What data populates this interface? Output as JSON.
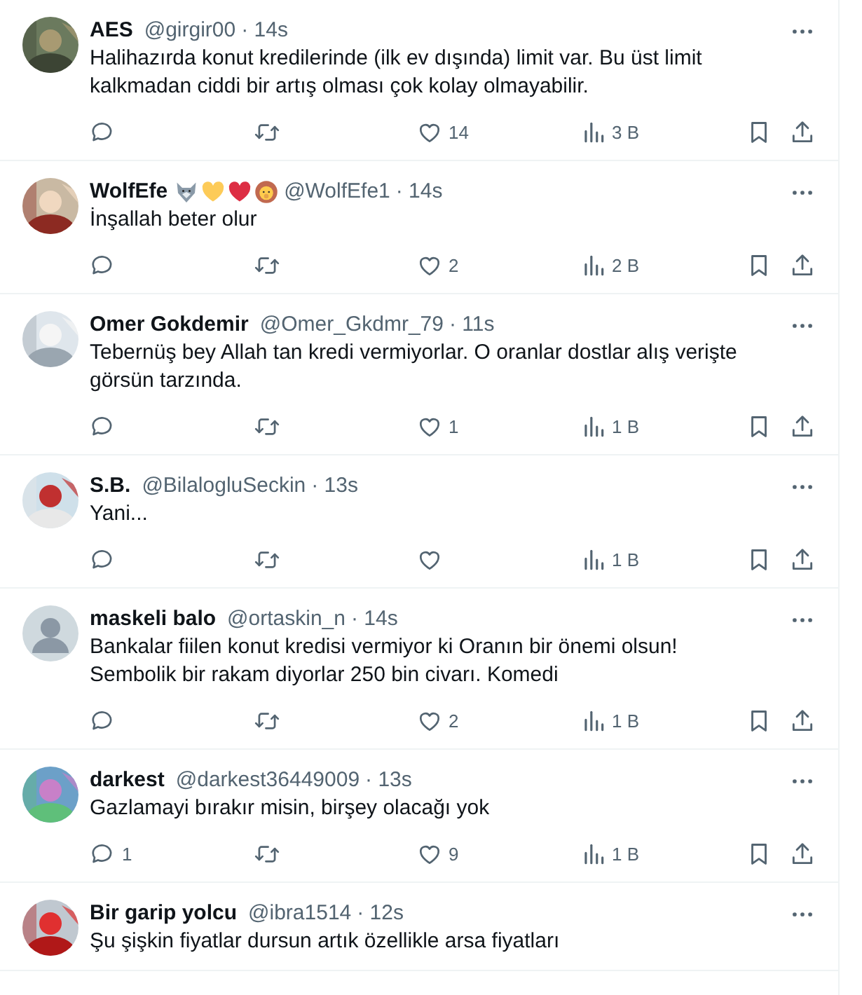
{
  "tweets": [
    {
      "name": "AES",
      "handle": "@girgir00",
      "time": "· 14s",
      "text": "Halihazırda konut kredilerinde (ilk ev dışında) limit var. Bu üst limit kalkmadan ciddi bir artış olması çok kolay olmayabilir.",
      "stats": {
        "likes": "14",
        "views": "3 B"
      }
    },
    {
      "name": "WolfEfe",
      "emoji": [
        {
          "kind": "wolf"
        },
        {
          "kind": "yellow-heart"
        },
        {
          "kind": "red-heart"
        },
        {
          "kind": "lion"
        }
      ],
      "handle": "@WolfEfe1",
      "time": "· 14s",
      "text": "İnşallah beter olur",
      "stats": {
        "likes": "2",
        "views": "2 B"
      }
    },
    {
      "name": "Omer Gokdemir",
      "handle": "@Omer_Gkdmr_79",
      "time": "· 11s",
      "text": "Tebernüş bey Allah tan kredi vermiyorlar. O oranlar dostlar alış verişte görsün tarzında.",
      "stats": {
        "likes": "1",
        "views": "1 B"
      }
    },
    {
      "name": "S.B.",
      "handle": "@BilalogluSeckin",
      "time": "· 13s",
      "text": "Yani...",
      "stats": {
        "views": "1 B"
      }
    },
    {
      "avatar": {
        "kind": "default"
      },
      "name": "maskeli balo",
      "handle": "@ortaskin_n",
      "time": "· 14s",
      "text": "Bankalar fiilen konut kredisi vermiyor ki Oranın bir önemi olsun! Sembolik bir rakam diyorlar 250 bin civarı. Komedi",
      "stats": {
        "likes": "2",
        "views": "1 B"
      }
    },
    {
      "name": "darkest",
      "handle": "@darkest36449009",
      "time": "· 13s",
      "text": "Gazlamayi bırakır misin, birşey olacağı yok",
      "stats": {
        "replies": "1",
        "likes": "9",
        "views": "1 B"
      }
    },
    {
      "name": "Bir garip yolcu",
      "handle": "@ibra1514",
      "time": "· 12s",
      "text": "Şu şişkin fiyatlar dursun artık özellikle arsa fiyatları"
    }
  ]
}
